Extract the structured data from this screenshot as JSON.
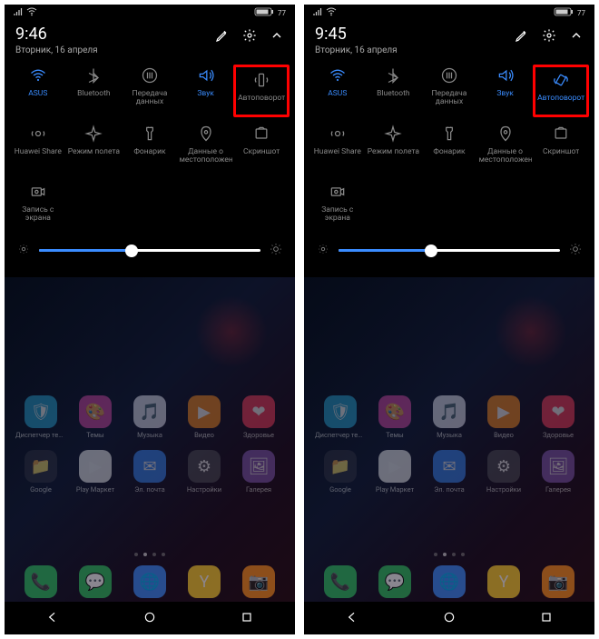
{
  "phones": [
    {
      "status": {
        "battery": "77"
      },
      "time": "9:46",
      "date": "Вторник, 16 апреля",
      "brightness_pct": 42,
      "autorotate_active": false
    },
    {
      "status": {
        "battery": "77"
      },
      "time": "9:45",
      "date": "Вторник, 16 апреля",
      "brightness_pct": 42,
      "autorotate_active": true
    }
  ],
  "toggles_row1": [
    {
      "name": "wifi",
      "label": "ASUS",
      "active": true
    },
    {
      "name": "bluetooth",
      "label": "Bluetooth",
      "active": false
    },
    {
      "name": "data",
      "label": "Передача данных",
      "active": false
    },
    {
      "name": "sound",
      "label": "Звук",
      "active": true
    },
    {
      "name": "autorotate",
      "label": "Автоповорот",
      "active": false,
      "highlight": true
    }
  ],
  "toggles_row2": [
    {
      "name": "huawei-share",
      "label": "Huawei Share"
    },
    {
      "name": "airplane",
      "label": "Режим полета"
    },
    {
      "name": "flashlight",
      "label": "Фонарик"
    },
    {
      "name": "location",
      "label": "Данные о местоположении"
    },
    {
      "name": "screenshot",
      "label": "Скриншот"
    }
  ],
  "toggles_row3": [
    {
      "name": "screen-record",
      "label": "Запись с экрана"
    }
  ],
  "apps_row1": [
    {
      "label": "Диспетчер телефона",
      "bg": "#2aa8d8",
      "char": "🛡"
    },
    {
      "label": "Темы",
      "bg": "#d84aa8",
      "char": "🎨"
    },
    {
      "label": "Музыка",
      "bg": "#e8e8f5",
      "char": "🎵"
    },
    {
      "label": "Видео",
      "bg": "#ff9020",
      "char": "▶"
    },
    {
      "label": "Здоровье",
      "bg": "#ff4060",
      "char": "❤"
    }
  ],
  "apps_row2": [
    {
      "label": "Google",
      "bg": "#303040",
      "char": "📁"
    },
    {
      "label": "Play Маркет",
      "bg": "#f8f8f8",
      "char": "▶"
    },
    {
      "label": "Эл. почта",
      "bg": "#3a8cff",
      "char": "✉"
    },
    {
      "label": "Настройки",
      "bg": "#505058",
      "char": "⚙"
    },
    {
      "label": "Галерея",
      "bg": "#8a60c0",
      "char": "🖼"
    }
  ],
  "dock": [
    {
      "label": "",
      "bg": "#30c060",
      "char": "📞"
    },
    {
      "label": "",
      "bg": "#30c060",
      "char": "💬"
    },
    {
      "label": "",
      "bg": "#3a8cff",
      "char": "🌐"
    },
    {
      "label": "",
      "bg": "#ffd030",
      "char": "Y"
    },
    {
      "label": "",
      "bg": "#ff9020",
      "char": "📷"
    }
  ]
}
